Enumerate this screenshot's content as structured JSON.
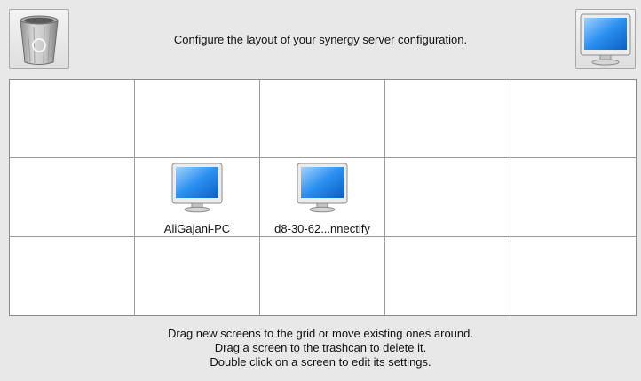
{
  "header": {
    "instruction": "Configure the layout of your synergy server configuration."
  },
  "trash": {
    "icon": "trash-icon"
  },
  "new_screen": {
    "icon": "monitor-icon"
  },
  "grid": {
    "rows": 3,
    "columns": 5,
    "screens": [
      {
        "row": 1,
        "col": 1,
        "name": "AliGajani-PC"
      },
      {
        "row": 1,
        "col": 2,
        "name": "d8-30-62...nnectify"
      }
    ]
  },
  "footer": {
    "line1": "Drag new screens to the grid or move existing ones around.",
    "line2": "Drag a screen to the trashcan to delete it.",
    "line3": "Double click on a screen to edit its settings."
  },
  "colors": {
    "background": "#e8e8e8",
    "grid_line": "#9a9a9a",
    "screen_blue": "#1f86e6"
  }
}
